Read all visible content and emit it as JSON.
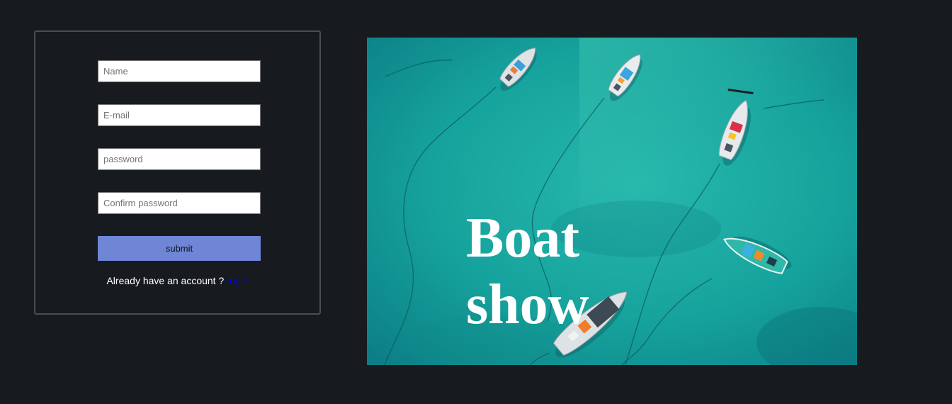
{
  "form": {
    "name_placeholder": "Name",
    "email_placeholder": "E-mail",
    "password_placeholder": "password",
    "confirm_placeholder": "Confirm password",
    "submit_label": "submit",
    "account_prompt": "Already have an account ?",
    "login_link": "Login"
  },
  "hero": {
    "title": "Boat show",
    "image_subject": "aerial view of small boats on turquoise water"
  },
  "colors": {
    "background": "#171a1e",
    "card_border": "#4a4d52",
    "submit_button": "#6f86d6",
    "link": "#0000ee",
    "water": "#1ba8a0"
  }
}
